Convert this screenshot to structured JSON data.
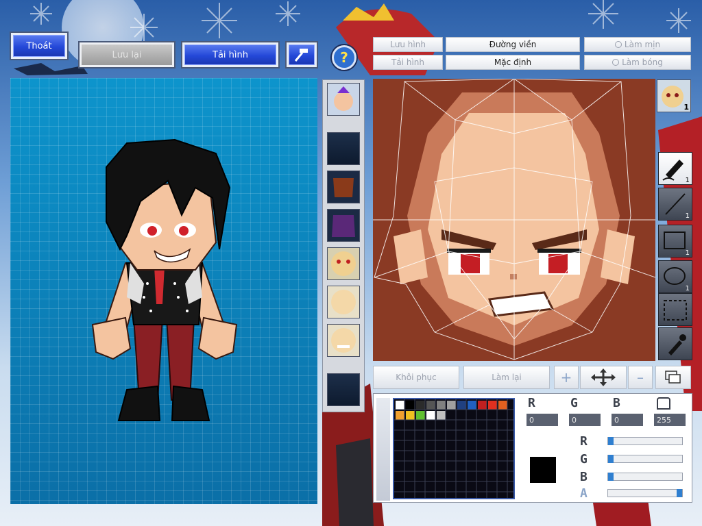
{
  "top_buttons": {
    "exit": "Thoát",
    "save": "Lưu lại",
    "reload": "Tải hình",
    "hammer_icon": "hammer-icon",
    "help_icon": "question-mark-icon"
  },
  "editor_buttons": {
    "save_image": "Lưu hình",
    "load_image": "Tải hình",
    "outline": "Đường viền",
    "default": "Mặc định",
    "smooth": "Làm mịn",
    "shade": "Làm bóng",
    "restore": "Khôi phục",
    "redo": "Làm lại"
  },
  "tools": [
    {
      "icon": "pen-icon",
      "count": "1",
      "active": true
    },
    {
      "icon": "line-icon",
      "count": "1",
      "active": false
    },
    {
      "icon": "rectangle-icon",
      "count": "1",
      "active": false
    },
    {
      "icon": "ellipse-icon",
      "count": "1",
      "active": false
    },
    {
      "icon": "selection-icon",
      "count": "",
      "active": false
    },
    {
      "icon": "eyedropper-icon",
      "count": "",
      "active": false
    }
  ],
  "face_preview_count": "1",
  "color": {
    "r_label": "R",
    "g_label": "G",
    "b_label": "B",
    "a_label": "A",
    "r": "0",
    "g": "0",
    "b": "0",
    "a": "255",
    "r_level": 0.0,
    "g_level": 0.0,
    "b_level": 0.0,
    "a_level": 1.0,
    "current_hex": "#000000"
  },
  "swatches": [
    "#ffffff",
    "#000000",
    "#2b2b2b",
    "#555555",
    "#808080",
    "#a0a0a0",
    "#204080",
    "#2060c0",
    "#c02020",
    "#e03020",
    "#e06020",
    "#f0a030",
    "#f0c020",
    "#60c030",
    "#ffffff",
    "#c0c0c0"
  ],
  "colors": {
    "accent": "#2448d8",
    "canvas": "#0e8fc4",
    "face_bg": "#8a3a24"
  }
}
